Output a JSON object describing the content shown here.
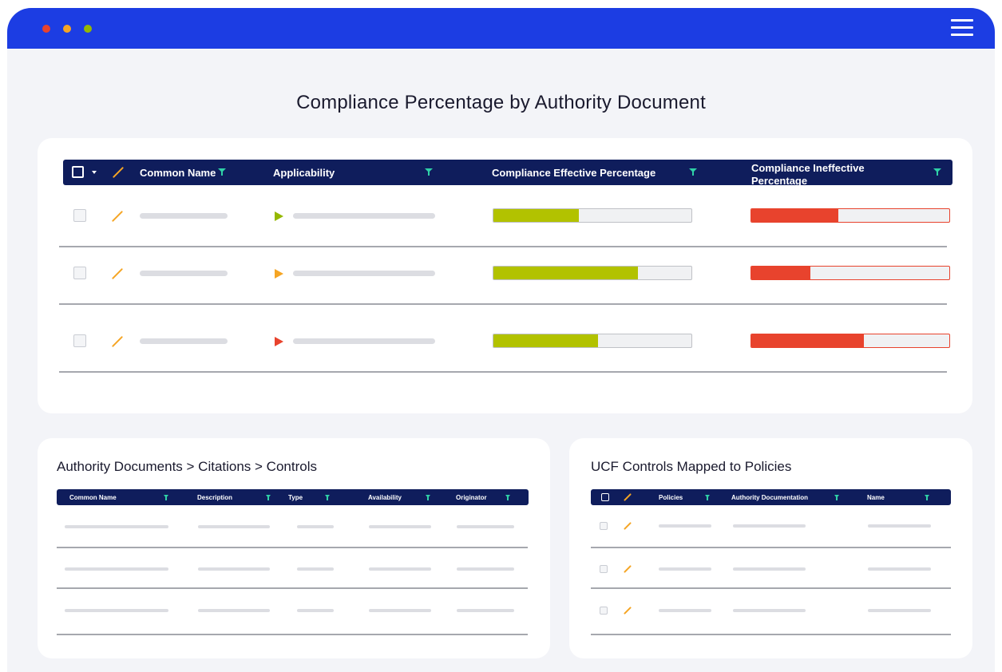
{
  "window": {
    "traffic_lights": [
      "#e8432d",
      "#f5a524",
      "#95b800"
    ],
    "menu_icon": "hamburger-menu-icon"
  },
  "main": {
    "title": "Compliance Percentage by Authority Document",
    "table": {
      "headers": {
        "common_name": "Common Name",
        "applicability": "Applicability",
        "effective": "Compliance Effective Percentage",
        "ineffective": "Compliance Ineffective Percentage"
      },
      "rows": [
        {
          "status_color": "#95b800",
          "effective_fraction": 0.43,
          "ineffective_fraction": 0.44
        },
        {
          "status_color": "#f5a524",
          "effective_fraction": 0.73,
          "ineffective_fraction": 0.3
        },
        {
          "status_color": "#e8432d",
          "effective_fraction": 0.53,
          "ineffective_fraction": 0.57
        }
      ]
    }
  },
  "citations_panel": {
    "title": "Authority Documents > Citations > Controls",
    "headers": [
      "Common Name",
      "Description",
      "Type",
      "Availability",
      "Originator"
    ],
    "row_count": 3
  },
  "ucf_panel": {
    "title": "UCF Controls Mapped to Policies",
    "headers": [
      "Policies",
      "Authority Documentation",
      "Name"
    ],
    "row_count": 3
  },
  "colors": {
    "titlebar": "#1c3de3",
    "header": "#0f1d5c",
    "filter": "#2fd1a7",
    "effective": "#b2c200",
    "ineffective": "#e8432d"
  }
}
